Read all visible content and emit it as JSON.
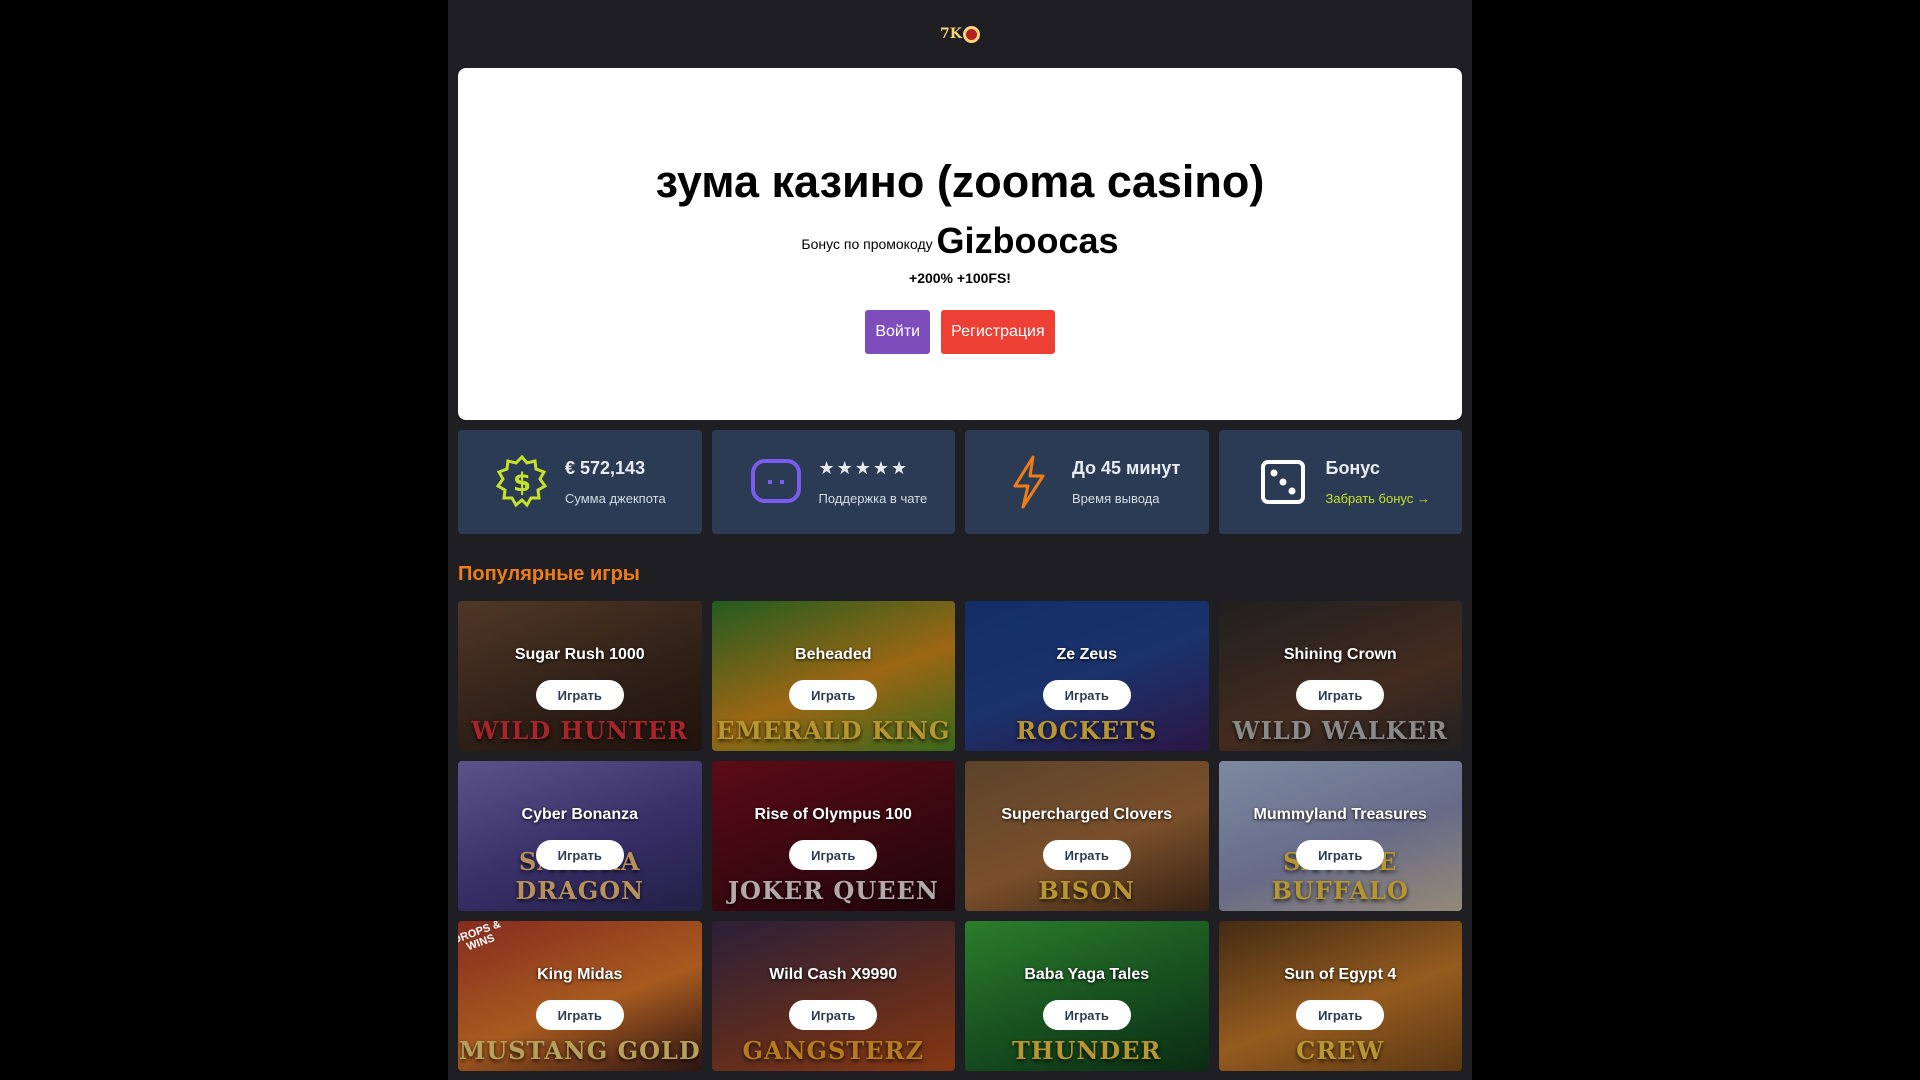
{
  "header": {
    "logo_text": "7K"
  },
  "hero": {
    "title": "зума казино (zooma casino)",
    "promo_prefix": "Бонус по промокоду",
    "promo_code": "Gizboocas",
    "offer": "+200% +100FS!",
    "login_label": "Войти",
    "register_label": "Регистрация"
  },
  "features": [
    {
      "icon": "dollar-badge-icon",
      "title": "€ 572,143",
      "subtitle": "Сумма джекпота"
    },
    {
      "icon": "chat-icon",
      "title": "★★★★★",
      "subtitle": "Поддержка в чате",
      "rating": 5
    },
    {
      "icon": "lightning-icon",
      "title": "До 45 минут",
      "subtitle": "Время вывода"
    },
    {
      "icon": "dice-icon",
      "title": "Бонус",
      "subtitle": "Забрать бонус →"
    }
  ],
  "popular": {
    "title": "Популярные игры",
    "play_label": "Играть",
    "games": [
      {
        "name": "Sugar Rush 1000",
        "art": "WILD HUNTER",
        "art_color": "#e0303a"
      },
      {
        "name": "Beheaded",
        "art": "EMERALD KING",
        "art_color": "#f5c842"
      },
      {
        "name": "Ze Zeus",
        "art": "ROCKETS",
        "art_color": "#f5c842"
      },
      {
        "name": "Shining Crown",
        "art": "WILD WALKER",
        "art_color": "#b8b8b8"
      },
      {
        "name": "Cyber Bonanza",
        "art": "SAKURA DRAGON",
        "art_color": "#f5c07a"
      },
      {
        "name": "Rise of Olympus 100",
        "art": "JOKER QUEEN",
        "art_color": "#f0e0e0"
      },
      {
        "name": "Supercharged Clovers",
        "art": "BISON",
        "art_color": "#f5c842"
      },
      {
        "name": "Mummyland Treasures",
        "art": "SAVAGE BUFFALO",
        "art_color": "#f5c842"
      },
      {
        "name": "King Midas",
        "art": "MUSTANG GOLD",
        "art_color": "#f5d67a",
        "ribbon": "DROPS & WINS"
      },
      {
        "name": "Wild Cash X9990",
        "art": "GANGSTERZ",
        "art_color": "#f5a42a"
      },
      {
        "name": "Baba Yaga Tales",
        "art": "THUNDER",
        "art_color": "#f5c842"
      },
      {
        "name": "Sun of Egypt 4",
        "art": "CREW",
        "art_color": "#f5c842"
      }
    ]
  },
  "colors": {
    "accent_orange": "#f07c18",
    "login_purple": "#7c4dbb",
    "register_red": "#ed4035",
    "feature_card_bg": "#2b3b53",
    "link_lime": "#c6e12c"
  }
}
